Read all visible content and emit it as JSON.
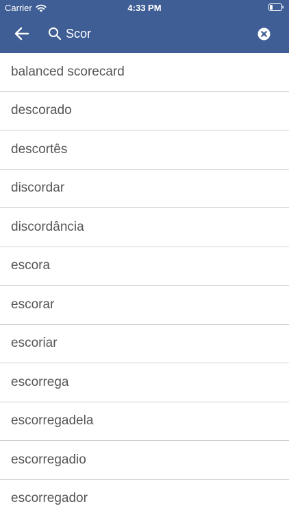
{
  "status_bar": {
    "carrier": "Carrier",
    "time": "4:33 PM",
    "wifi_icon": "wifi-icon",
    "battery_icon": "battery-icon"
  },
  "toolbar": {
    "back_icon": "arrow-left-icon",
    "search_icon": "search-icon",
    "query": "Scor",
    "clear_icon": "clear-circle-icon"
  },
  "results": [
    "balanced scorecard",
    "descorado",
    "descortês",
    "discordar",
    "discordância",
    "escora",
    "escorar",
    "escoriar",
    "escorrega",
    "escorregadela",
    "escorregadio",
    "escorregador"
  ],
  "colors": {
    "header_bg": "#3f5e95",
    "header_text": "#ffffff",
    "item_text": "#555555",
    "divider": "#d0d0d0"
  }
}
